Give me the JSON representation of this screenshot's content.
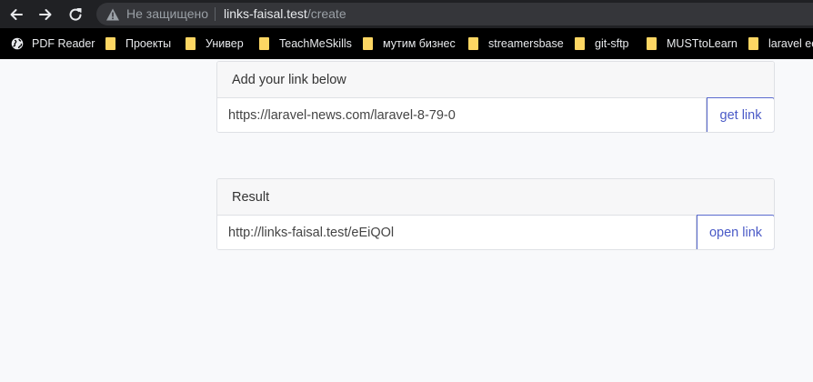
{
  "browser": {
    "security_label": "Не защищено",
    "url_host": "links-faisal.test",
    "url_path": "/create"
  },
  "bookmarks": [
    {
      "label": "PDF Reader",
      "icon": "globe-icon"
    },
    {
      "label": "Проекты",
      "icon": "folder-icon"
    },
    {
      "label": "Универ",
      "icon": "folder-icon"
    },
    {
      "label": "TeachMeSkills",
      "icon": "folder-icon"
    },
    {
      "label": "мутим бизнес",
      "icon": "folder-icon"
    },
    {
      "label": "streamersbase",
      "icon": "folder-icon"
    },
    {
      "label": "git-sftp",
      "icon": "folder-icon"
    },
    {
      "label": "MUSTtoLearn",
      "icon": "folder-icon"
    },
    {
      "label": "laravel ec",
      "icon": "folder-icon"
    }
  ],
  "form": {
    "header": "Add your link below",
    "input_value": "https://laravel-news.com/laravel-8-79-0",
    "button_label": "get link"
  },
  "result": {
    "header": "Result",
    "output_value": "http://links-faisal.test/eEiQOl",
    "button_label": "open link"
  },
  "colors": {
    "accent": "#4a5ac7",
    "bookmark_folder": "#fdd663",
    "chrome_bar": "#202124"
  }
}
